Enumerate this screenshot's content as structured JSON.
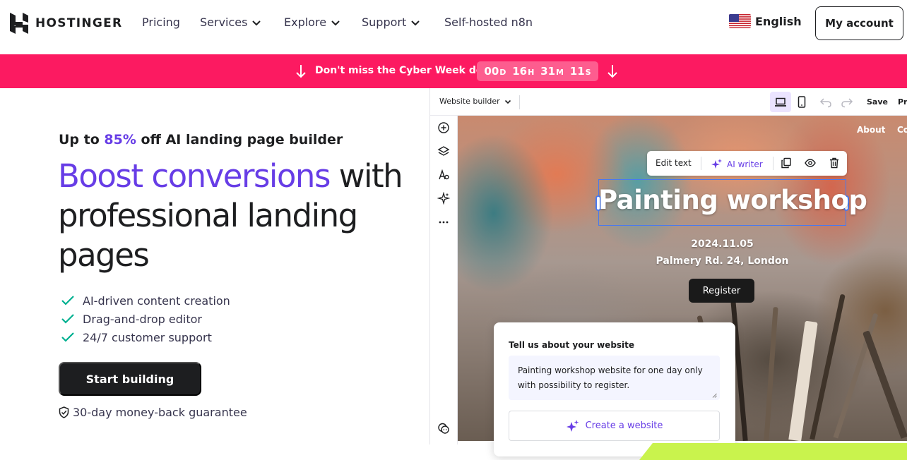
{
  "nav": {
    "logo_text": "HOSTINGER",
    "links": {
      "pricing": "Pricing",
      "services": "Services",
      "explore": "Explore",
      "support": "Support",
      "self_hosted": "Self-hosted n8n"
    },
    "language": "English",
    "account_button": "My account"
  },
  "promo": {
    "text": "Don't miss the Cyber Week deals",
    "timer": {
      "days": "00",
      "days_unit": "D",
      "hours": "16",
      "hours_unit": "H",
      "minutes": "31",
      "minutes_unit": "M",
      "seconds": "11",
      "seconds_unit": "S"
    },
    "background_color": "#fc1a61"
  },
  "hero": {
    "eyebrow_prefix": "Up to ",
    "eyebrow_percent": "85%",
    "eyebrow_suffix": " off AI landing page builder",
    "headline_accent": "Boost conversions",
    "headline_rest": " with professional landing pages",
    "features": [
      "AI-driven content creation",
      "Drag-and-drop editor",
      "24/7 customer support"
    ],
    "cta_button": "Start building",
    "guarantee": "30-day money-back guarantee",
    "accent_color": "#673de6"
  },
  "builder": {
    "mode_select": "Website builder",
    "save_label": "Save",
    "preview_label": "Pre",
    "canvas_nav": {
      "about": "About",
      "contact": "Co"
    },
    "toolbar": {
      "edit_text": "Edit text",
      "ai_writer": "AI writer"
    },
    "event": {
      "title": "Painting workshop",
      "date": "2024.11.05",
      "address": "Palmery Rd. 24, London",
      "register_button": "Register"
    }
  },
  "ai_panel": {
    "title": "Tell us about your website",
    "prompt_value": "Painting workshop website for one day only with possibility to register.",
    "create_button": "Create a website"
  }
}
